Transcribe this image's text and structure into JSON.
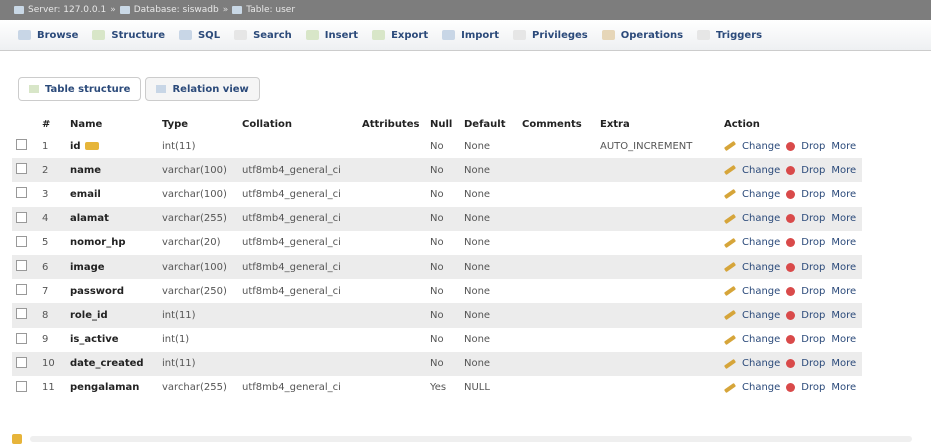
{
  "breadcrumb": {
    "items": [
      "Server: 127.0.0.1",
      "Database: siswadb",
      "Table: user"
    ]
  },
  "tabs": [
    {
      "label": "Browse"
    },
    {
      "label": "Structure"
    },
    {
      "label": "SQL"
    },
    {
      "label": "Search"
    },
    {
      "label": "Insert"
    },
    {
      "label": "Export"
    },
    {
      "label": "Import"
    },
    {
      "label": "Privileges"
    },
    {
      "label": "Operations"
    },
    {
      "label": "Triggers"
    }
  ],
  "subtabs": [
    {
      "label": "Table structure"
    },
    {
      "label": "Relation view"
    }
  ],
  "table": {
    "headers": [
      "#",
      "Name",
      "Type",
      "Collation",
      "Attributes",
      "Null",
      "Default",
      "Comments",
      "Extra",
      "Action"
    ],
    "rows": [
      {
        "n": "1",
        "name": "id",
        "type": "int(11)",
        "collation": "",
        "null": "No",
        "default": "None",
        "extra": "AUTO_INCREMENT",
        "key": true
      },
      {
        "n": "2",
        "name": "name",
        "type": "varchar(100)",
        "collation": "utf8mb4_general_ci",
        "null": "No",
        "default": "None",
        "extra": ""
      },
      {
        "n": "3",
        "name": "email",
        "type": "varchar(100)",
        "collation": "utf8mb4_general_ci",
        "null": "No",
        "default": "None",
        "extra": ""
      },
      {
        "n": "4",
        "name": "alamat",
        "type": "varchar(255)",
        "collation": "utf8mb4_general_ci",
        "null": "No",
        "default": "None",
        "extra": ""
      },
      {
        "n": "5",
        "name": "nomor_hp",
        "type": "varchar(20)",
        "collation": "utf8mb4_general_ci",
        "null": "No",
        "default": "None",
        "extra": ""
      },
      {
        "n": "6",
        "name": "image",
        "type": "varchar(100)",
        "collation": "utf8mb4_general_ci",
        "null": "No",
        "default": "None",
        "extra": ""
      },
      {
        "n": "7",
        "name": "password",
        "type": "varchar(250)",
        "collation": "utf8mb4_general_ci",
        "null": "No",
        "default": "None",
        "extra": ""
      },
      {
        "n": "8",
        "name": "role_id",
        "type": "int(11)",
        "collation": "",
        "null": "No",
        "default": "None",
        "extra": ""
      },
      {
        "n": "9",
        "name": "is_active",
        "type": "int(1)",
        "collation": "",
        "null": "No",
        "default": "None",
        "extra": ""
      },
      {
        "n": "10",
        "name": "date_created",
        "type": "int(11)",
        "collation": "",
        "null": "No",
        "default": "None",
        "extra": ""
      },
      {
        "n": "11",
        "name": "pengalaman",
        "type": "varchar(255)",
        "collation": "utf8mb4_general_ci",
        "null": "Yes",
        "default": "NULL",
        "extra": ""
      }
    ],
    "action_labels": {
      "change": "Change",
      "drop": "Drop",
      "more": "More"
    }
  }
}
